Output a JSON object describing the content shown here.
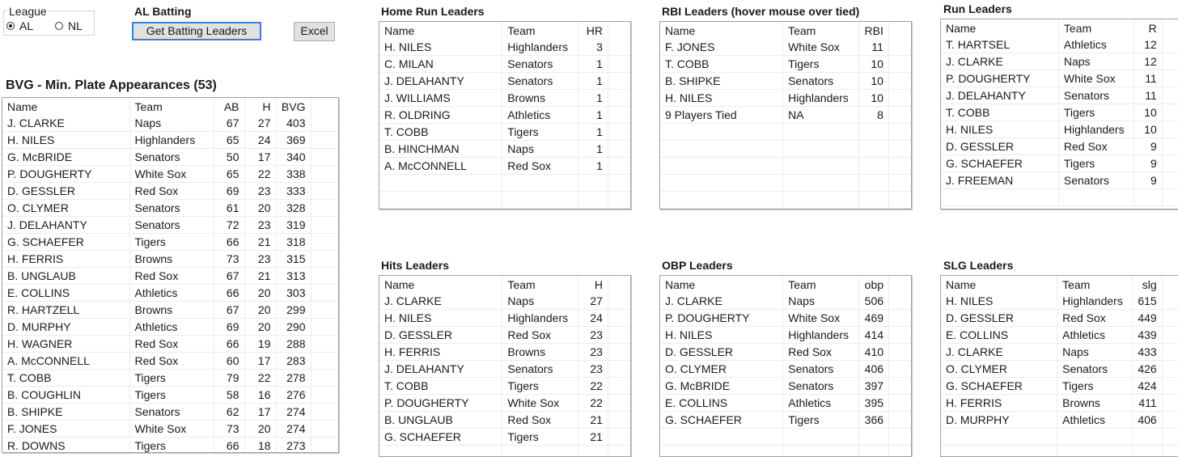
{
  "league": {
    "legend": "League",
    "options": [
      {
        "label": "AL",
        "selected": true
      },
      {
        "label": "NL",
        "selected": false
      }
    ]
  },
  "header": {
    "title": "AL Batting",
    "get_button": "Get Batting Leaders",
    "excel_button": "Excel"
  },
  "bvg": {
    "title": "BVG - Min. Plate Appearances (53)",
    "columns": [
      "Name",
      "Team",
      "AB",
      "H",
      "BVG"
    ],
    "rows": [
      [
        "J. CLARKE",
        "Naps",
        "67",
        "27",
        "403"
      ],
      [
        "H. NILES",
        "Highlanders",
        "65",
        "24",
        "369"
      ],
      [
        "G. McBRIDE",
        "Senators",
        "50",
        "17",
        "340"
      ],
      [
        "P. DOUGHERTY",
        "White Sox",
        "65",
        "22",
        "338"
      ],
      [
        "D. GESSLER",
        "Red Sox",
        "69",
        "23",
        "333"
      ],
      [
        "O. CLYMER",
        "Senators",
        "61",
        "20",
        "328"
      ],
      [
        "J. DELAHANTY",
        "Senators",
        "72",
        "23",
        "319"
      ],
      [
        "G. SCHAEFER",
        "Tigers",
        "66",
        "21",
        "318"
      ],
      [
        "H. FERRIS",
        "Browns",
        "73",
        "23",
        "315"
      ],
      [
        "B. UNGLAUB",
        "Red Sox",
        "67",
        "21",
        "313"
      ],
      [
        "E. COLLINS",
        "Athletics",
        "66",
        "20",
        "303"
      ],
      [
        "R. HARTZELL",
        "Browns",
        "67",
        "20",
        "299"
      ],
      [
        "D. MURPHY",
        "Athletics",
        "69",
        "20",
        "290"
      ],
      [
        "H. WAGNER",
        "Red Sox",
        "66",
        "19",
        "288"
      ],
      [
        "A. McCONNELL",
        "Red Sox",
        "60",
        "17",
        "283"
      ],
      [
        "T. COBB",
        "Tigers",
        "79",
        "22",
        "278"
      ],
      [
        "B. COUGHLIN",
        "Tigers",
        "58",
        "16",
        "276"
      ],
      [
        "B. SHIPKE",
        "Senators",
        "62",
        "17",
        "274"
      ],
      [
        "F. JONES",
        "White Sox",
        "73",
        "20",
        "274"
      ],
      [
        "R. DOWNS",
        "Tigers",
        "66",
        "18",
        "273"
      ]
    ]
  },
  "leaders": [
    {
      "key": "hr",
      "title": "Home Run Leaders",
      "columns": [
        "Name",
        "Team",
        "HR"
      ],
      "empty_rows": 2,
      "rows": [
        [
          "H. NILES",
          "Highlanders",
          "3"
        ],
        [
          "C. MILAN",
          "Senators",
          "1"
        ],
        [
          "J. DELAHANTY",
          "Senators",
          "1"
        ],
        [
          "J. WILLIAMS",
          "Browns",
          "1"
        ],
        [
          "R. OLDRING",
          "Athletics",
          "1"
        ],
        [
          "T. COBB",
          "Tigers",
          "1"
        ],
        [
          "B. HINCHMAN",
          "Naps",
          "1"
        ],
        [
          "A. McCONNELL",
          "Red Sox",
          "1"
        ]
      ]
    },
    {
      "key": "rbi",
      "title": "RBI Leaders (hover mouse over tied)",
      "columns": [
        "Name",
        "Team",
        "RBI"
      ],
      "empty_rows": 5,
      "rows": [
        [
          "F. JONES",
          "White Sox",
          "11"
        ],
        [
          "T. COBB",
          "Tigers",
          "10"
        ],
        [
          "B. SHIPKE",
          "Senators",
          "10"
        ],
        [
          "H. NILES",
          "Highlanders",
          "10"
        ],
        [
          "9 Players Tied",
          "NA",
          "8"
        ]
      ]
    },
    {
      "key": "runs",
      "title": "Run Leaders",
      "columns": [
        "Name",
        "Team",
        "R"
      ],
      "empty_rows": 1,
      "rows": [
        [
          "T. HARTSEL",
          "Athletics",
          "12"
        ],
        [
          "J. CLARKE",
          "Naps",
          "12"
        ],
        [
          "P. DOUGHERTY",
          "White Sox",
          "11"
        ],
        [
          "J. DELAHANTY",
          "Senators",
          "11"
        ],
        [
          "T. COBB",
          "Tigers",
          "10"
        ],
        [
          "H. NILES",
          "Highlanders",
          "10"
        ],
        [
          "D. GESSLER",
          "Red Sox",
          "9"
        ],
        [
          "G. SCHAEFER",
          "Tigers",
          "9"
        ],
        [
          "J. FREEMAN",
          "Senators",
          "9"
        ]
      ]
    },
    {
      "key": "hits",
      "title": "Hits Leaders",
      "columns": [
        "Name",
        "Team",
        "H"
      ],
      "empty_rows": 1,
      "rows": [
        [
          "J. CLARKE",
          "Naps",
          "27"
        ],
        [
          "H. NILES",
          "Highlanders",
          "24"
        ],
        [
          "D. GESSLER",
          "Red Sox",
          "23"
        ],
        [
          "H. FERRIS",
          "Browns",
          "23"
        ],
        [
          "J. DELAHANTY",
          "Senators",
          "23"
        ],
        [
          "T. COBB",
          "Tigers",
          "22"
        ],
        [
          "P. DOUGHERTY",
          "White Sox",
          "22"
        ],
        [
          "B. UNGLAUB",
          "Red Sox",
          "21"
        ],
        [
          "G. SCHAEFER",
          "Tigers",
          "21"
        ]
      ]
    },
    {
      "key": "obp",
      "title": "OBP Leaders",
      "columns": [
        "Name",
        "Team",
        "obp"
      ],
      "empty_rows": 2,
      "rows": [
        [
          "J. CLARKE",
          "Naps",
          "506"
        ],
        [
          "P. DOUGHERTY",
          "White Sox",
          "469"
        ],
        [
          "H. NILES",
          "Highlanders",
          "414"
        ],
        [
          "D. GESSLER",
          "Red Sox",
          "410"
        ],
        [
          "O. CLYMER",
          "Senators",
          "406"
        ],
        [
          "G. McBRIDE",
          "Senators",
          "397"
        ],
        [
          "E. COLLINS",
          "Athletics",
          "395"
        ],
        [
          "G. SCHAEFER",
          "Tigers",
          "366"
        ]
      ]
    },
    {
      "key": "slg",
      "title": "SLG Leaders",
      "columns": [
        "Name",
        "Team",
        "slg"
      ],
      "empty_rows": 2,
      "rows": [
        [
          "H. NILES",
          "Highlanders",
          "615"
        ],
        [
          "D. GESSLER",
          "Red Sox",
          "449"
        ],
        [
          "E. COLLINS",
          "Athletics",
          "439"
        ],
        [
          "J. CLARKE",
          "Naps",
          "433"
        ],
        [
          "O. CLYMER",
          "Senators",
          "426"
        ],
        [
          "G. SCHAEFER",
          "Tigers",
          "424"
        ],
        [
          "H. FERRIS",
          "Browns",
          "411"
        ],
        [
          "D. MURPHY",
          "Athletics",
          "406"
        ]
      ]
    }
  ]
}
